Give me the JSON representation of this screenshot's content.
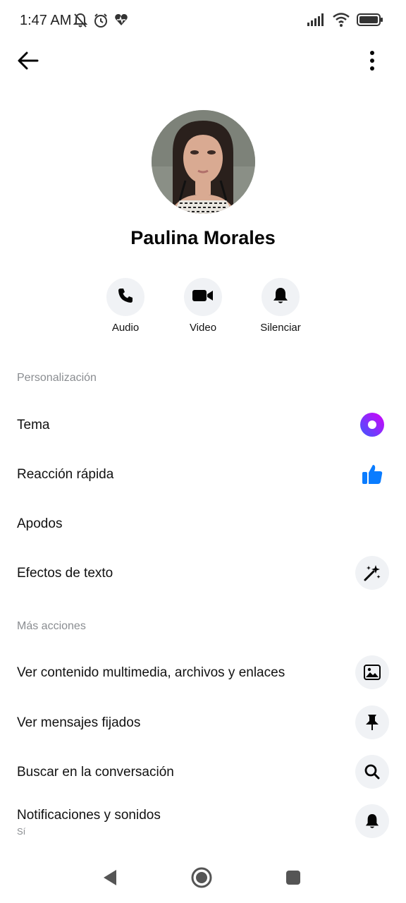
{
  "status_bar": {
    "time": "1:47 AM",
    "left_icons": [
      "muted-bell-icon",
      "alarm-clock-icon",
      "heart-rate-icon"
    ],
    "right_icons": [
      "signal-icon",
      "wifi-icon",
      "battery-icon"
    ]
  },
  "top_bar": {
    "back_icon": "arrow-left-icon",
    "more_icon": "vertical-dots-icon"
  },
  "profile": {
    "name": "Paulina Morales"
  },
  "actions": [
    {
      "label": "Audio",
      "icon": "phone-icon"
    },
    {
      "label": "Video",
      "icon": "video-camera-icon"
    },
    {
      "label": "Silenciar",
      "icon": "bell-icon"
    }
  ],
  "personalization": {
    "title": "Personalización",
    "items": [
      {
        "label": "Tema",
        "icon": "theme-circle-icon"
      },
      {
        "label": "Reacción rápida",
        "icon": "thumbs-up-icon"
      },
      {
        "label": "Apodos"
      },
      {
        "label": "Efectos de texto",
        "icon": "magic-wand-icon"
      }
    ]
  },
  "more_actions": {
    "title": "Más acciones",
    "items": [
      {
        "label": "Ver contenido multimedia, archivos y enlaces",
        "icon": "image-icon"
      },
      {
        "label": "Ver mensajes fijados",
        "icon": "pin-icon"
      },
      {
        "label": "Buscar en la conversación",
        "icon": "search-icon"
      },
      {
        "label": "Notificaciones y sonidos",
        "sublabel": "Sí",
        "icon": "bell-icon"
      }
    ]
  },
  "nav_bar": {
    "icons": [
      "back-triangle-icon",
      "home-circle-icon",
      "recents-square-icon"
    ]
  },
  "colors": {
    "theme_gradient_start": "#3d5afe",
    "theme_gradient_end": "#d500f9",
    "thumbs_up": "#0a7cff",
    "icon_bg": "#f0f2f5"
  }
}
